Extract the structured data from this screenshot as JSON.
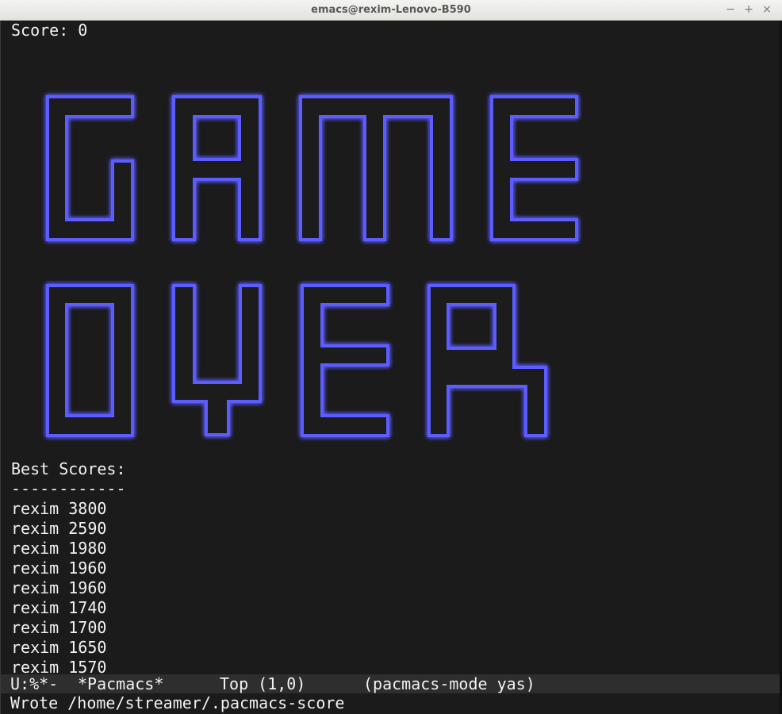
{
  "window": {
    "title": "emacs@rexim-Lenovo-B590",
    "controls": {
      "minimize": "−",
      "maximize": "+",
      "close": "×"
    }
  },
  "game": {
    "score_text": "Score: 0",
    "banner_words": [
      "GAME",
      "OVER"
    ],
    "wall_color": "#5c5cff",
    "best_scores_heading": "Best Scores:",
    "separator": "------------",
    "best_scores": [
      {
        "name": "rexim",
        "score": 3800
      },
      {
        "name": "rexim",
        "score": 2590
      },
      {
        "name": "rexim",
        "score": 1980
      },
      {
        "name": "rexim",
        "score": 1960
      },
      {
        "name": "rexim",
        "score": 1960
      },
      {
        "name": "rexim",
        "score": 1740
      },
      {
        "name": "rexim",
        "score": 1700
      },
      {
        "name": "rexim",
        "score": 1650
      },
      {
        "name": "rexim",
        "score": 1570
      }
    ]
  },
  "modeline": {
    "status": "U:%*-",
    "buffer": "*Pacmacs*",
    "position": "Top (1,0)",
    "modes": "(pacmacs-mode yas)"
  },
  "echo_area": {
    "message": "Wrote /home/streamer/.pacmacs-score"
  }
}
